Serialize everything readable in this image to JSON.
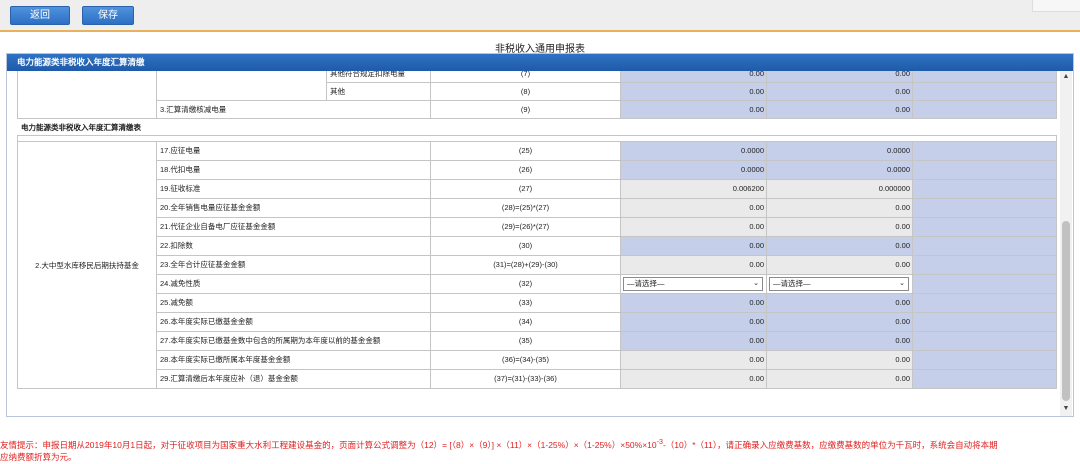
{
  "toolbar": {
    "back_label": "返回",
    "save_label": "保存"
  },
  "form_title": "非税收入通用申报表",
  "panel_title": "电力能源类非税收入年度汇算清缴",
  "upper_rows": [
    {
      "item": "其他符合规定扣除电量",
      "code": "(7)",
      "v1": "0.00",
      "v2": "0.00"
    },
    {
      "item": "其他",
      "code": "(8)",
      "v1": "0.00",
      "v2": "0.00"
    },
    {
      "item": "3.汇算清缴核减电量",
      "code": "(9)",
      "v1": "0.00",
      "v2": "0.00"
    }
  ],
  "section_title": "电力能源类非税收入年度汇算清缴表",
  "fund_name": "2.大中型水库移民后期扶持基金",
  "select_placeholder": "—请选择—",
  "rows": [
    {
      "item": "17.应征电量",
      "code": "(25)",
      "v1": "0.0000",
      "v2": "0.0000",
      "style": "blue"
    },
    {
      "item": "18.代扣电量",
      "code": "(26)",
      "v1": "0.0000",
      "v2": "0.0000",
      "style": "blue"
    },
    {
      "item": "19.征收标准",
      "code": "(27)",
      "v1": "0.006200",
      "v2": "0.000000",
      "style": "grey"
    },
    {
      "item": "20.全年销售电量应征基金金额",
      "code": "(28)=(25)*(27)",
      "v1": "0.00",
      "v2": "0.00",
      "style": "grey"
    },
    {
      "item": "21.代征企业自备电厂应征基金金额",
      "code": "(29)=(26)*(27)",
      "v1": "0.00",
      "v2": "0.00",
      "style": "grey"
    },
    {
      "item": "22.扣除数",
      "code": "(30)",
      "v1": "0.00",
      "v2": "0.00",
      "style": "blue"
    },
    {
      "item": "23.全年合计应征基金金额",
      "code": "(31)=(28)+(29)-(30)",
      "v1": "0.00",
      "v2": "0.00",
      "style": "grey"
    },
    {
      "item": "24.减免性质",
      "code": "(32)",
      "v1": "",
      "v2": "",
      "style": "select"
    },
    {
      "item": "25.减免额",
      "code": "(33)",
      "v1": "0.00",
      "v2": "0.00",
      "style": "blue"
    },
    {
      "item": "26.本年度实际已缴基金金额",
      "code": "(34)",
      "v1": "0.00",
      "v2": "0.00",
      "style": "blue"
    },
    {
      "item": "27.本年度实际已缴基金数中包含的所属期为本年度以前的基金金额",
      "code": "(35)",
      "v1": "0.00",
      "v2": "0.00",
      "style": "blue"
    },
    {
      "item": "28.本年度实际已缴所属本年度基金金额",
      "code": "(36)=(34)-(35)",
      "v1": "0.00",
      "v2": "0.00",
      "style": "grey"
    },
    {
      "item": "29.汇算清缴后本年度应补（退）基金金额",
      "code": "(37)=(31)-(33)-(36)",
      "v1": "0.00",
      "v2": "0.00",
      "style": "grey"
    }
  ],
  "tip": {
    "line1_pre": "友情提示：申报日期从2019年10月1日起，对于征收项目为国家重大水利工程建设基金的，页面计算公式调整为（12）= [（8）×（9）] ×（11）×（1-25%）×（1-25%）×50%×10",
    "sup": "-3",
    "line1_post": "-（10）*（11），请正确录入应缴费基数，应缴费基数的单位为千瓦时，系统会自动将本期",
    "line2": "应纳费额折算为元。"
  },
  "colors": {
    "header_blue": "#2566b8",
    "cell_blue": "#c5cfea",
    "cell_grey": "#eaeaea",
    "tip_red": "#e02020",
    "accent_orange": "#e8b15c"
  }
}
